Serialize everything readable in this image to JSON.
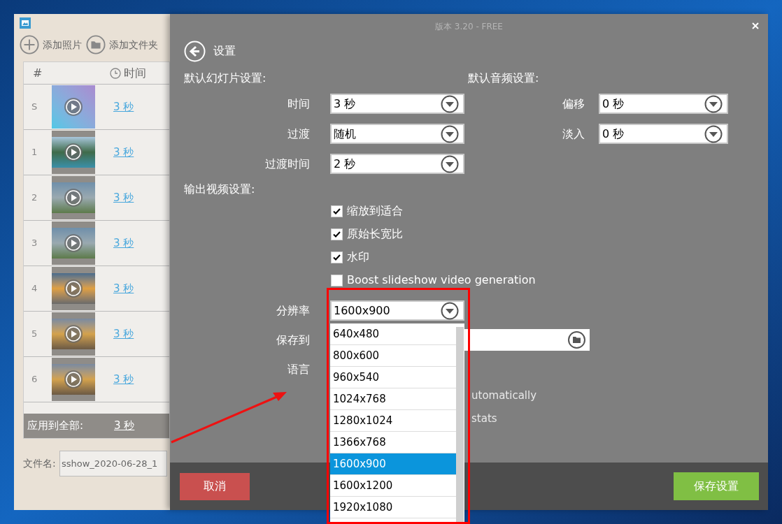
{
  "left_panel": {
    "toolbar": [
      {
        "kind": "add",
        "label": "添加照片"
      },
      {
        "kind": "folder",
        "label": "添加文件夹"
      }
    ],
    "columns": [
      "#",
      "时间"
    ],
    "rows": [
      {
        "index": "S",
        "kind": "gradient",
        "duration": "3 秒"
      },
      {
        "index": "1",
        "kind": "lake",
        "duration": "3 秒"
      },
      {
        "index": "2",
        "kind": "fog",
        "duration": "3 秒"
      },
      {
        "index": "3",
        "kind": "fog",
        "duration": "3 秒"
      },
      {
        "index": "4",
        "kind": "sunset",
        "duration": "3 秒"
      },
      {
        "index": "5",
        "kind": "tree",
        "duration": "3 秒"
      },
      {
        "index": "6",
        "kind": "tree",
        "duration": "3 秒"
      }
    ],
    "apply_all": {
      "label": "应用到全部:",
      "duration": "3 秒"
    },
    "filename": {
      "label": "文件名:",
      "value": "sshow_2020-06-28_1"
    }
  },
  "settings": {
    "version": "版本 3.20 - FREE",
    "title": "设置",
    "slideshow_heading": "默认幻灯片设置:",
    "slideshow_fields": [
      {
        "label": "时间",
        "value": "3 秒"
      },
      {
        "label": "过渡",
        "value": "随机"
      },
      {
        "label": "过渡时间",
        "value": "2 秒"
      }
    ],
    "audio_heading": "默认音频设置:",
    "audio_fields": [
      {
        "label": "偏移",
        "value": "0 秒"
      },
      {
        "label": "淡入",
        "value": "0 秒"
      }
    ],
    "output_heading": "输出视频设置:",
    "options": [
      {
        "label": "缩放到适合",
        "checked": true
      },
      {
        "label": "原始长宽比",
        "checked": true
      },
      {
        "label": "水印",
        "checked": true
      },
      {
        "label": "Boost slideshow video generation",
        "checked": false
      }
    ],
    "resolution": {
      "label": "分辨率",
      "value": "1600x900",
      "expanded": true,
      "options": [
        {
          "label": "640x480",
          "selected": false
        },
        {
          "label": "800x600",
          "selected": false
        },
        {
          "label": "960x540",
          "selected": false
        },
        {
          "label": "1024x768",
          "selected": false
        },
        {
          "label": "1280x1024",
          "selected": false
        },
        {
          "label": "1366x768",
          "selected": false
        },
        {
          "label": "1600x900",
          "selected": true
        },
        {
          "label": "1600x1200",
          "selected": false
        },
        {
          "label": "1920x1080",
          "selected": false
        }
      ]
    },
    "save_to": {
      "label": "保存到"
    },
    "language": {
      "label": "语言"
    },
    "covered_options": [
      "utomatically",
      "stats"
    ]
  },
  "footer": {
    "cancel": "取消",
    "save": "保存设置"
  }
}
